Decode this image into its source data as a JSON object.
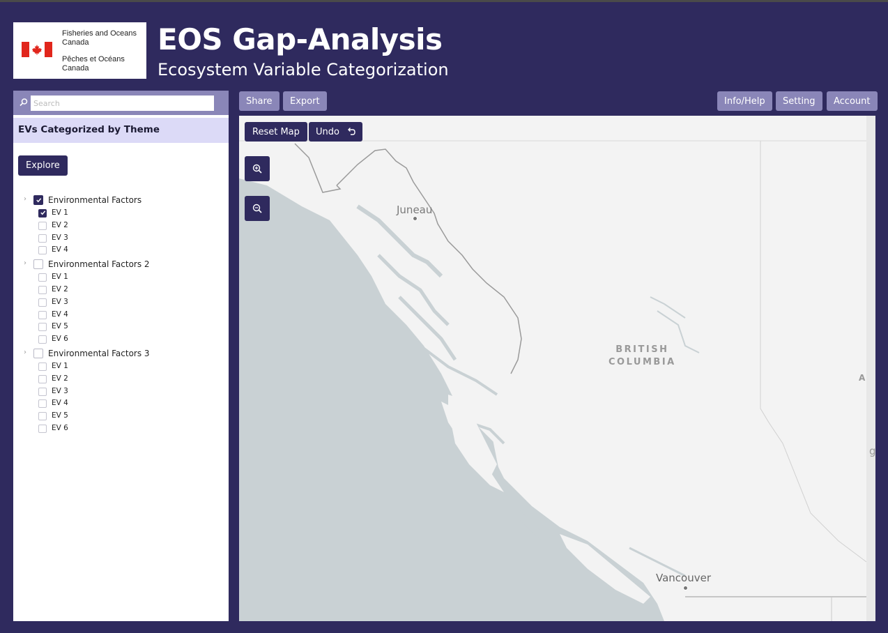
{
  "header": {
    "logo": {
      "en_line1": "Fisheries and Oceans",
      "en_line2": "Canada",
      "fr_line1": "Pêches et Océans",
      "fr_line2": "Canada"
    },
    "title": "EOS Gap-Analysis",
    "subtitle": "Ecosystem Variable Categorization"
  },
  "sidebar": {
    "search_placeholder": "Search",
    "heading": "EVs Categorized by Theme",
    "explore_label": "Explore",
    "groups": [
      {
        "label": "Environmental Factors",
        "checked": true,
        "items": [
          {
            "label": "EV 1",
            "checked": true
          },
          {
            "label": "EV 2",
            "checked": false
          },
          {
            "label": "EV 3",
            "checked": false
          },
          {
            "label": "EV 4",
            "checked": false
          }
        ]
      },
      {
        "label": "Environmental Factors 2",
        "checked": false,
        "items": [
          {
            "label": "EV 1",
            "checked": false
          },
          {
            "label": "EV 2",
            "checked": false
          },
          {
            "label": "EV 3",
            "checked": false
          },
          {
            "label": "EV 4",
            "checked": false
          },
          {
            "label": "EV 5",
            "checked": false
          },
          {
            "label": "EV 6",
            "checked": false
          }
        ]
      },
      {
        "label": "Environmental Factors 3",
        "checked": false,
        "items": [
          {
            "label": "EV 1",
            "checked": false
          },
          {
            "label": "EV 2",
            "checked": false
          },
          {
            "label": "EV 3",
            "checked": false
          },
          {
            "label": "EV 4",
            "checked": false
          },
          {
            "label": "EV 5",
            "checked": false
          },
          {
            "label": "EV 6",
            "checked": false
          }
        ]
      }
    ]
  },
  "toolbar": {
    "share_label": "Share",
    "export_label": "Export",
    "info_label": "Info/Help",
    "setting_label": "Setting",
    "account_label": "Account"
  },
  "map": {
    "reset_label": "Reset Map",
    "undo_label": "Undo",
    "zoom_in_icon": "zoom-in-icon",
    "zoom_out_icon": "zoom-out-icon",
    "labels": {
      "juneau": "Juneau",
      "province_line1": "BRITISH",
      "province_line2": "COLUMBIA",
      "vancouver": "Vancouver",
      "edge_a": "A",
      "edge_g": "g"
    }
  },
  "colors": {
    "background": "#2f2a5e",
    "accent_button": "#8a86b8",
    "heading_band": "#dcdaf7",
    "water": "#c9d1d4",
    "land": "#f3f3f3"
  }
}
